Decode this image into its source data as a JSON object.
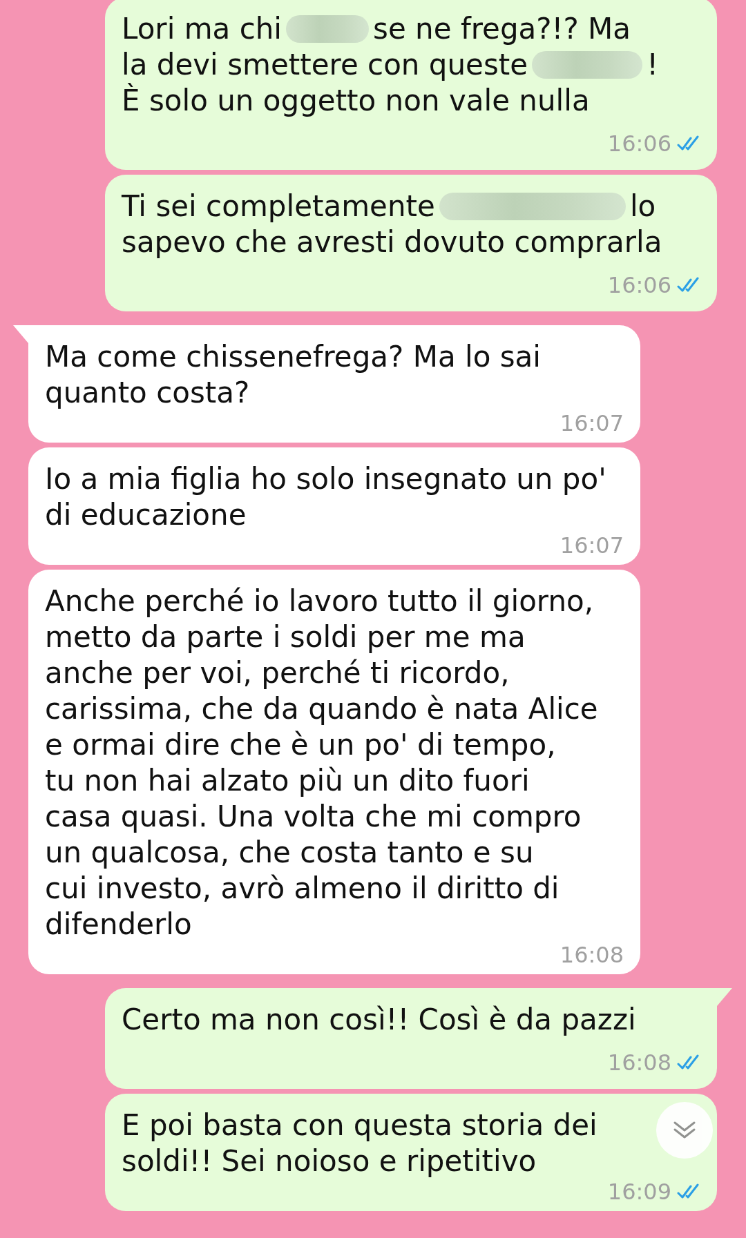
{
  "messages": [
    {
      "outgoing": true,
      "tail": false,
      "lines": [
        [
          {
            "kind": "text",
            "text": "Lori ma chi"
          },
          {
            "kind": "redaction"
          },
          {
            "kind": "text",
            "text": "se ne frega?!? Ma"
          }
        ],
        [
          {
            "kind": "text",
            "text": "la devi smettere con queste"
          },
          {
            "kind": "redaction"
          },
          {
            "kind": "text",
            "text": "!"
          }
        ],
        [
          {
            "kind": "text",
            "text": "È solo un oggetto non vale nulla"
          }
        ]
      ],
      "time": "16:06",
      "read": true
    },
    {
      "outgoing": true,
      "tail": false,
      "lines": [
        [
          {
            "kind": "text",
            "text": "Ti sei completamente"
          },
          {
            "kind": "redaction"
          },
          {
            "kind": "text",
            "text": "lo"
          }
        ],
        [
          {
            "kind": "text",
            "text": "sapevo che avresti dovuto comprarla"
          }
        ]
      ],
      "time": "16:06",
      "read": true
    },
    {
      "outgoing": false,
      "tail": true,
      "lines": [
        [
          {
            "kind": "text",
            "text": "Ma come chissenefrega? Ma lo sai"
          }
        ],
        [
          {
            "kind": "text",
            "text": "quanto costa?"
          }
        ]
      ],
      "time": "16:07"
    },
    {
      "outgoing": false,
      "tail": false,
      "lines": [
        [
          {
            "kind": "text",
            "text": "Io a mia figlia ho solo insegnato un po'"
          }
        ],
        [
          {
            "kind": "text",
            "text": "di educazione"
          }
        ]
      ],
      "time": "16:07"
    },
    {
      "outgoing": false,
      "tail": false,
      "lines": [
        [
          {
            "kind": "text",
            "text": "Anche perché io lavoro tutto il giorno,"
          }
        ],
        [
          {
            "kind": "text",
            "text": "metto da parte i soldi per me ma"
          }
        ],
        [
          {
            "kind": "text",
            "text": "anche per voi, perché ti ricordo,"
          }
        ],
        [
          {
            "kind": "text",
            "text": "carissima, che da quando è nata Alice"
          }
        ],
        [
          {
            "kind": "text",
            "text": "e ormai dire che è un po' di tempo,"
          }
        ],
        [
          {
            "kind": "text",
            "text": "tu non hai alzato più un dito fuori"
          }
        ],
        [
          {
            "kind": "text",
            "text": "casa quasi. Una volta che mi compro"
          }
        ],
        [
          {
            "kind": "text",
            "text": "un qualcosa, che costa tanto e su"
          }
        ],
        [
          {
            "kind": "text",
            "text": "cui investo, avrò almeno il diritto di"
          }
        ],
        [
          {
            "kind": "text",
            "text": "difenderlo"
          }
        ]
      ],
      "time": "16:08"
    },
    {
      "outgoing": true,
      "tail": true,
      "lines": [
        [
          {
            "kind": "text",
            "text": "Certo ma non così!! Così è da pazzi"
          }
        ]
      ],
      "time": "16:08",
      "read": true
    },
    {
      "outgoing": true,
      "tail": false,
      "lines": [
        [
          {
            "kind": "text",
            "text": "E poi basta con questa storia dei"
          }
        ],
        [
          {
            "kind": "text",
            "text": "soldi!! Sei noioso e ripetitivo"
          }
        ]
      ],
      "time": "16:09",
      "read": true
    }
  ],
  "scroll_down_button": {
    "visible": true
  }
}
